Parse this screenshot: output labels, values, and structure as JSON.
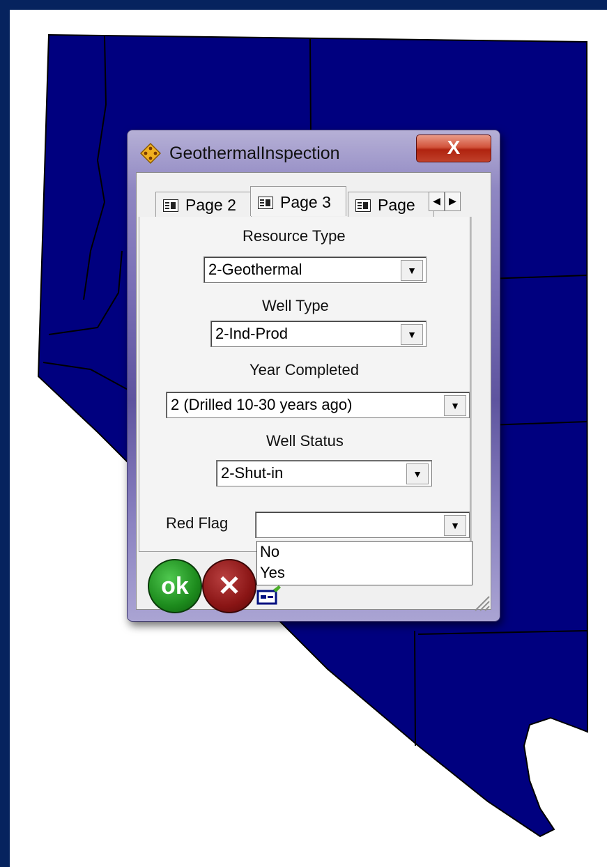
{
  "window": {
    "title": "GeothermalInspection",
    "close_label": "X"
  },
  "tabs": [
    {
      "label": "Page 2"
    },
    {
      "label": "Page 3"
    },
    {
      "label": "Page"
    }
  ],
  "tab_scroll": {
    "left": "◀",
    "right": "▶"
  },
  "fields": {
    "resource_type": {
      "label": "Resource Type",
      "value": "2-Geothermal"
    },
    "well_type": {
      "label": "Well Type",
      "value": "2-Ind-Prod"
    },
    "year_completed": {
      "label": "Year Completed",
      "value": "2 (Drilled 10-30 years ago)"
    },
    "well_status": {
      "label": "Well Status",
      "value": "2-Shut-in"
    },
    "red_flag": {
      "label": "Red Flag",
      "value": "",
      "options": [
        "No",
        "Yes"
      ]
    }
  },
  "buttons": {
    "ok_label": "ok",
    "cancel_label": "✕"
  },
  "dropdown_arrow": "▼",
  "colors": {
    "background": "#06235e",
    "map_fill": "#00007f",
    "map_border": "#000000",
    "ok": "#1d8b1d",
    "cancel": "#8a1515",
    "close": "#c0402a"
  }
}
